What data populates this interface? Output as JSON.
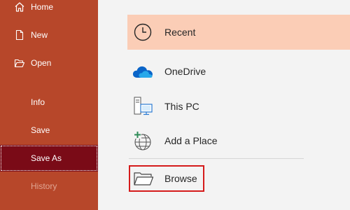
{
  "sidebar": {
    "items": [
      {
        "label": "Home",
        "icon": "home-icon"
      },
      {
        "label": "New",
        "icon": "new-document-icon"
      },
      {
        "label": "Open",
        "icon": "open-folder-icon"
      },
      {
        "label": "Info"
      },
      {
        "label": "Save"
      },
      {
        "label": "Save As",
        "selected": true
      },
      {
        "label": "History",
        "disabled": true
      }
    ]
  },
  "locations": [
    {
      "label": "Recent",
      "icon": "clock-icon",
      "highlighted": true
    },
    {
      "label": "OneDrive",
      "icon": "onedrive-cloud-icon"
    },
    {
      "label": "This PC",
      "icon": "this-pc-icon"
    },
    {
      "label": "Add a Place",
      "icon": "add-place-globe-icon"
    },
    {
      "label": "Browse",
      "icon": "browse-folder-icon",
      "outlined": true
    }
  ],
  "colors": {
    "sidebar_bg": "#b7472a",
    "selected_bg": "#7a0b17",
    "recent_highlight": "#fbcdb6",
    "browse_outline": "#d51b1b",
    "onedrive_blue": "#0a64c8"
  }
}
